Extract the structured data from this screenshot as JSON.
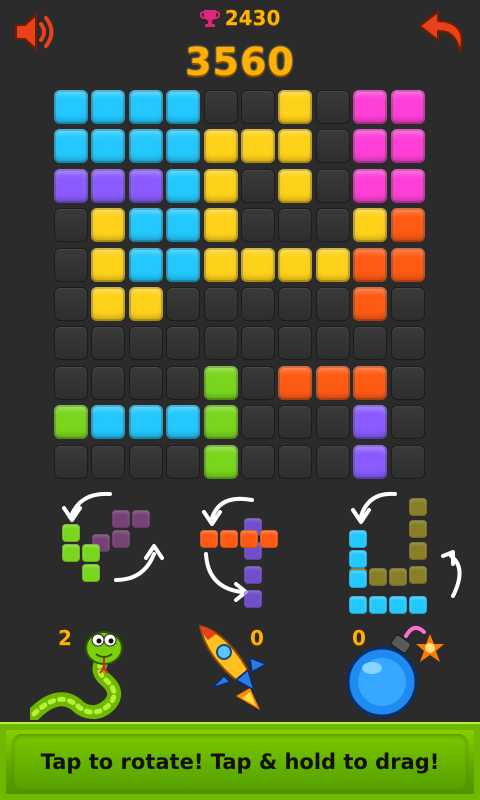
{
  "header": {
    "best_score": "2430",
    "score": "3560"
  },
  "colors": {
    "cyan": "#23c8ff",
    "yellow": "#ffd21a",
    "magenta": "#ff3fd7",
    "purple": "#8a5bff",
    "orange": "#ff5a14",
    "green": "#79d61d",
    "olive": "#a89b26",
    "mauve": "#8f4a8f"
  },
  "board": {
    "rows": [
      [
        "cyan",
        "cyan",
        "cyan",
        "cyan",
        "empty",
        "empty",
        "yellow",
        "empty",
        "magenta",
        "magenta"
      ],
      [
        "cyan",
        "cyan",
        "cyan",
        "cyan",
        "yellow",
        "yellow",
        "yellow",
        "empty",
        "magenta",
        "magenta"
      ],
      [
        "purple",
        "purple",
        "purple",
        "cyan",
        "yellow",
        "empty",
        "yellow",
        "empty",
        "magenta",
        "magenta"
      ],
      [
        "empty",
        "yellow",
        "cyan",
        "cyan",
        "yellow",
        "empty",
        "empty",
        "empty",
        "yellow",
        "orange"
      ],
      [
        "empty",
        "yellow",
        "cyan",
        "cyan",
        "yellow",
        "yellow",
        "yellow",
        "yellow",
        "orange",
        "orange"
      ],
      [
        "empty",
        "yellow",
        "yellow",
        "empty",
        "empty",
        "empty",
        "empty",
        "empty",
        "orange",
        "empty"
      ],
      [
        "empty",
        "empty",
        "empty",
        "empty",
        "empty",
        "empty",
        "empty",
        "empty",
        "empty",
        "empty"
      ],
      [
        "empty",
        "empty",
        "empty",
        "empty",
        "green",
        "empty",
        "orange",
        "orange",
        "orange",
        "empty"
      ],
      [
        "green",
        "cyan",
        "cyan",
        "cyan",
        "green",
        "empty",
        "empty",
        "empty",
        "purple",
        "empty"
      ],
      [
        "empty",
        "empty",
        "empty",
        "empty",
        "green",
        "empty",
        "empty",
        "empty",
        "purple",
        "empty"
      ]
    ]
  },
  "pieces": [
    {
      "name": "green-s-piece",
      "color": "green",
      "ghost_color": "mauve"
    },
    {
      "name": "orange-line-piece",
      "color": "orange",
      "ghost_color": "purple"
    },
    {
      "name": "cyan-l-piece",
      "color": "cyan",
      "ghost_color": "olive"
    }
  ],
  "powerups": {
    "snake_count": "2",
    "rocket_count": "0",
    "bomb_count": "0"
  },
  "hint": {
    "text": "Tap to rotate! Tap & hold to drag!"
  }
}
